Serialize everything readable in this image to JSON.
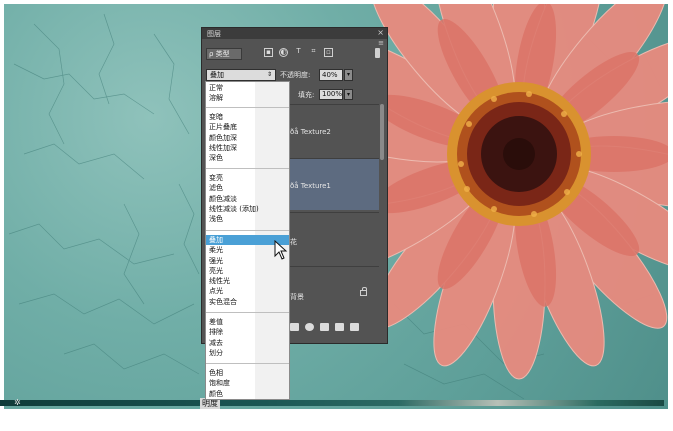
{
  "panel": {
    "tab_label": "图层",
    "close_icon": "×",
    "menu_icon": "≡",
    "filter": {
      "kind_label": "ρ 类型",
      "icons": [
        "image-filter-icon",
        "adjustment-filter-icon",
        "text-filter-icon",
        "shape-filter-icon",
        "smart-object-filter-icon"
      ]
    },
    "blend_mode": {
      "value": "叠加",
      "arrow": "⇕"
    },
    "opacity": {
      "label": "不透明度:",
      "value": "40%",
      "arrow": "▾"
    },
    "fill": {
      "label": "填充:",
      "value": "100%",
      "arrow": "▾"
    },
    "layers": [
      {
        "name": "ðå Texture2"
      },
      {
        "name": "ðå Texture1"
      },
      {
        "name": "花"
      },
      {
        "name": "背景"
      }
    ]
  },
  "dropdown": {
    "groups": [
      [
        "正常",
        "溶解"
      ],
      [
        "变暗",
        "正片叠底",
        "颜色加深",
        "线性加深",
        "深色"
      ],
      [
        "变亮",
        "滤色",
        "颜色减淡",
        "线性减淡 (添加)",
        "浅色"
      ],
      [
        "叠加",
        "柔光",
        "强光",
        "亮光",
        "线性光",
        "点光",
        "实色混合"
      ],
      [
        "差值",
        "排除",
        "减去",
        "划分"
      ],
      [
        "色相",
        "饱和度",
        "颜色",
        "明度"
      ]
    ],
    "highlighted": "叠加"
  },
  "colors": {
    "background_teal": "#6aa9a2",
    "flower_petal": "#e58478",
    "flower_center": "#3b1310",
    "panel_bg": "#535353",
    "highlight": "#4aa0d6",
    "selected_layer": "#5d6b80"
  }
}
